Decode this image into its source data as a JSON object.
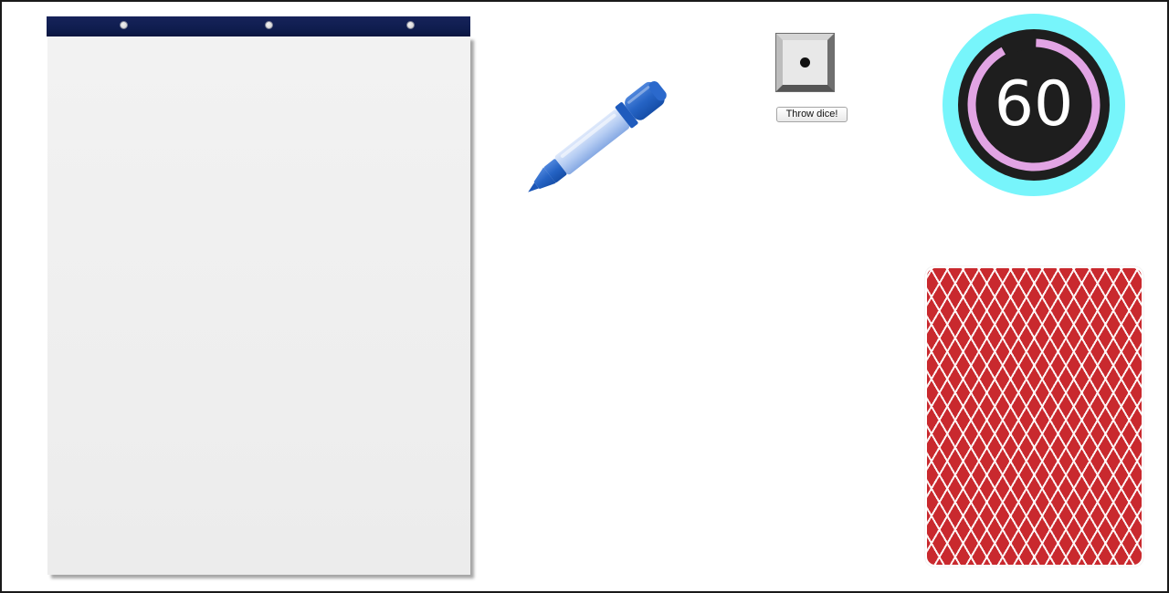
{
  "flipchart": {
    "binding_color": "#0f1d4f",
    "sheet_color": "#efefef"
  },
  "marker": {
    "icon": "blue-marker-icon",
    "color": "#1f5fc0"
  },
  "dice": {
    "face_value": 1,
    "throw_label": "Throw dice!"
  },
  "timer": {
    "value": "60",
    "ring_outer_color": "#77f5fb",
    "ring_progress_color": "#e2a4e4",
    "face_color": "#1e1e1e"
  },
  "card": {
    "icon": "card-back-icon",
    "pattern_color": "#c9292e"
  }
}
